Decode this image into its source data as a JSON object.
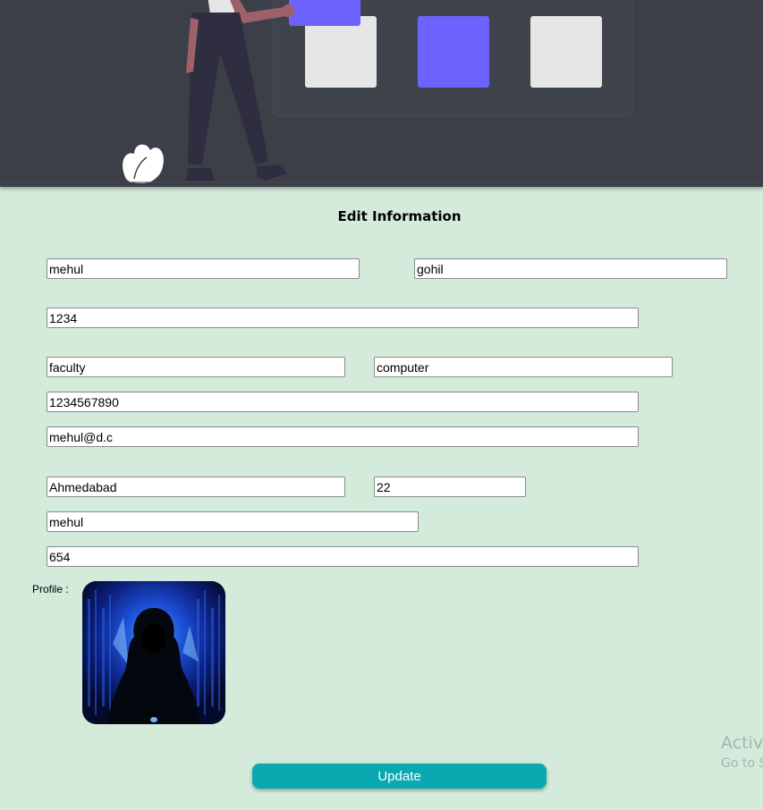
{
  "form": {
    "title": "Edit Information",
    "fields": {
      "first_name": "mehul",
      "last_name": "gohil",
      "password": "1234",
      "role": "faculty",
      "department": "computer",
      "phone": "1234567890",
      "email": "mehul@d.c",
      "city": "Ahmedabad",
      "age": "22",
      "username": "mehul",
      "code": "654"
    },
    "profile_label": "Profile :",
    "update_label": "Update"
  },
  "watermark": {
    "line1": "Activa",
    "line2": "Go to S"
  },
  "colors": {
    "page_background": "#d4ebdc",
    "hero_background": "#3c3f48",
    "accent_purple": "#6c63ff",
    "button_teal": "#0aa9b1"
  }
}
